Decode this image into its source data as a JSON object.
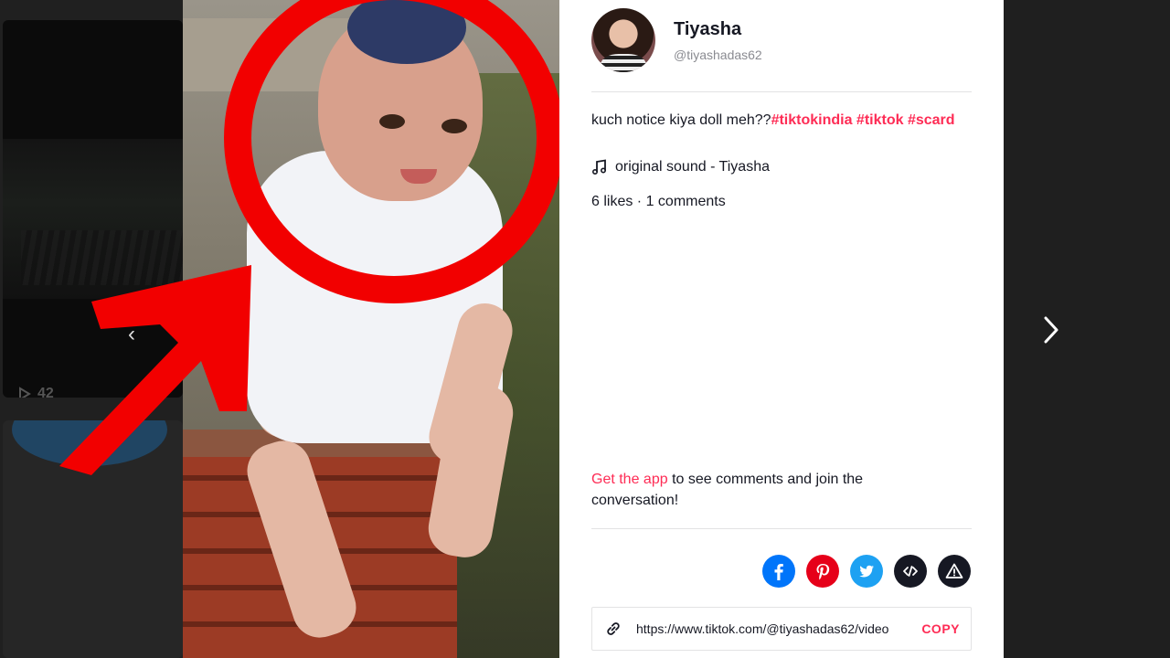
{
  "background_feed": {
    "view_count": "42"
  },
  "profile": {
    "display_name": "Tiyasha",
    "handle": "@tiyashadas62"
  },
  "caption": {
    "text": "kuch notice kiya doll meh??",
    "hashtags": [
      "#tiktokindia",
      "#tiktok",
      "#scard"
    ]
  },
  "sound": {
    "label": "original sound - Tiyasha",
    "icon": "music-note-icon"
  },
  "stats": {
    "text": "6 likes · 1 comments"
  },
  "get_app": {
    "link_text": "Get the app",
    "rest_text": " to see comments and join the conversation!"
  },
  "share": {
    "buttons": [
      {
        "name": "facebook",
        "icon": "facebook-icon",
        "color": "#0075fa"
      },
      {
        "name": "pinterest",
        "icon": "pinterest-icon",
        "color": "#e60019"
      },
      {
        "name": "twitter",
        "icon": "twitter-icon",
        "color": "#1da1f2"
      },
      {
        "name": "embed",
        "icon": "embed-code-icon",
        "color": "#161823"
      },
      {
        "name": "report",
        "icon": "warning-icon",
        "color": "#161823"
      }
    ]
  },
  "copy_link": {
    "url": "https://www.tiktok.com/@tiyashadas62/video",
    "button_label": "COPY"
  },
  "colors": {
    "accent": "#fe2c55",
    "overlay_red": "#f20000",
    "panel_bg": "#ffffff"
  }
}
